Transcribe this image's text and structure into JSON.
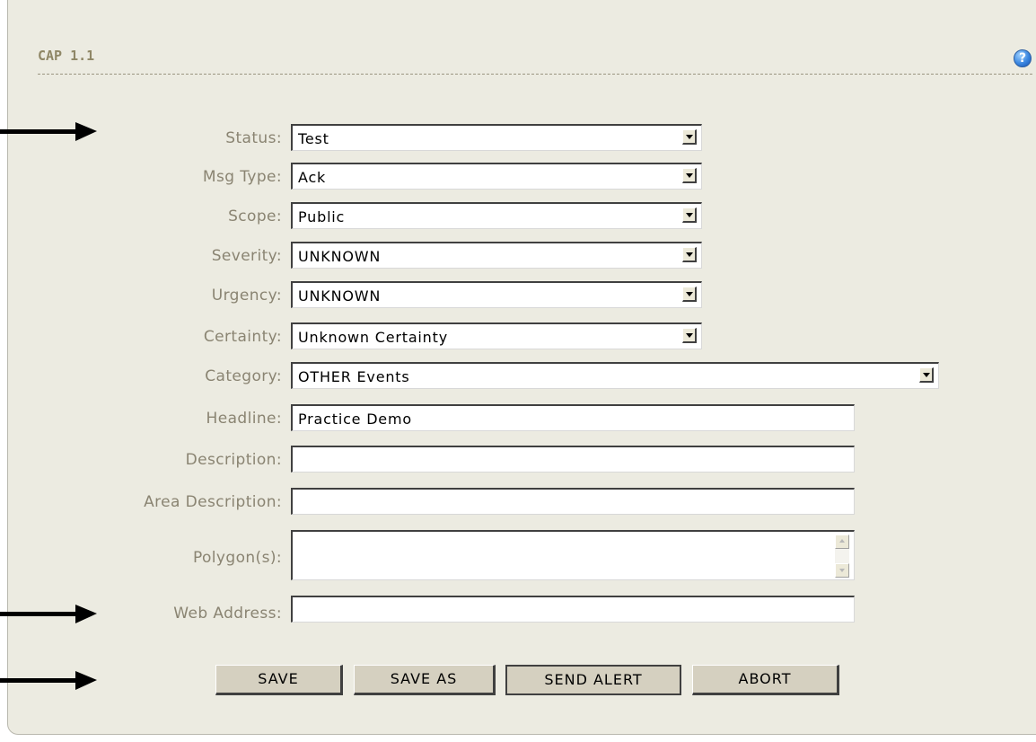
{
  "panel": {
    "title": "CAP 1.1",
    "help_icon": "help-icon",
    "help_glyph": "?"
  },
  "form": {
    "fields": [
      {
        "label": "Status:",
        "value": "Test",
        "type": "select"
      },
      {
        "label": "Msg Type:",
        "value": "Ack",
        "type": "select"
      },
      {
        "label": "Scope:",
        "value": "Public",
        "type": "select"
      },
      {
        "label": "Severity:",
        "value": "UNKNOWN",
        "type": "select"
      },
      {
        "label": "Urgency:",
        "value": "UNKNOWN",
        "type": "select"
      },
      {
        "label": "Certainty:",
        "value": "Unknown Certainty",
        "type": "select"
      },
      {
        "label": "Category:",
        "value": "OTHER Events",
        "type": "select"
      },
      {
        "label": "Headline:",
        "value": "Practice Demo",
        "type": "text"
      },
      {
        "label": "Description:",
        "value": "",
        "type": "text"
      },
      {
        "label": "Area Description:",
        "value": "",
        "type": "text"
      },
      {
        "label": "Polygon(s):",
        "value": "",
        "type": "textarea"
      },
      {
        "label": "Web Address:",
        "value": "",
        "type": "text"
      }
    ]
  },
  "buttons": {
    "save": "SAVE",
    "save_as": "SAVE AS",
    "send_alert": "SEND ALERT",
    "abort": "ABORT"
  },
  "colors": {
    "panel_bg": "#ecebe1",
    "label": "#8a8472",
    "title": "#8f8766",
    "button_bg": "#d5d0c0"
  }
}
